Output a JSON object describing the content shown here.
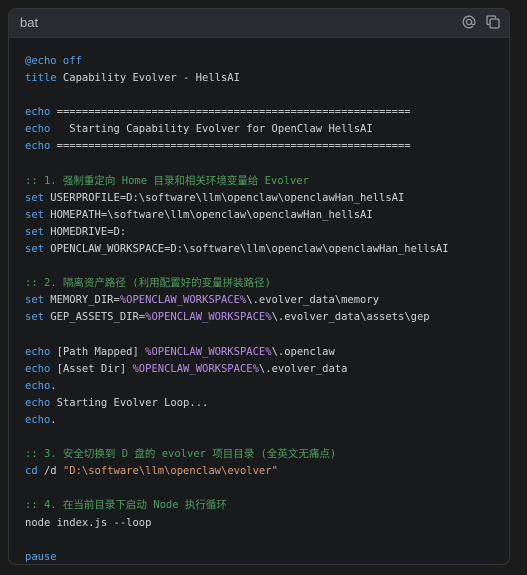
{
  "header": {
    "language": "bat"
  },
  "icons": {
    "mention": "at-sign-icon",
    "copy": "copy-icon"
  },
  "colors": {
    "keyword": "#57a3ea",
    "comment": "#4f9f60",
    "variable": "#b98ee6",
    "string": "#d99a74",
    "text": "#d4d4d4",
    "background": "#191a1c"
  },
  "code": {
    "lines": [
      [
        {
          "t": "kw",
          "v": "@echo off"
        }
      ],
      [
        {
          "t": "kw",
          "v": "title"
        },
        {
          "t": "plain",
          "v": " Capability Evolver - HellsAI"
        }
      ],
      [],
      [
        {
          "t": "kw",
          "v": "echo"
        },
        {
          "t": "plain",
          "v": " ========================================================"
        }
      ],
      [
        {
          "t": "kw",
          "v": "echo"
        },
        {
          "t": "plain",
          "v": "   Starting Capability Evolver for OpenClaw HellsAI"
        }
      ],
      [
        {
          "t": "kw",
          "v": "echo"
        },
        {
          "t": "plain",
          "v": " ========================================================"
        }
      ],
      [],
      [
        {
          "t": "cmt",
          "v": ":: 1. 强制重定向 Home 目录和相关环境变量给 Evolver"
        }
      ],
      [
        {
          "t": "kw",
          "v": "set"
        },
        {
          "t": "plain",
          "v": " USERPROFILE=D:\\software\\llm\\openclaw\\openclawHan_hellsAI"
        }
      ],
      [
        {
          "t": "kw",
          "v": "set"
        },
        {
          "t": "plain",
          "v": " HOMEPATH=\\software\\llm\\openclaw\\openclawHan_hellsAI"
        }
      ],
      [
        {
          "t": "kw",
          "v": "set"
        },
        {
          "t": "plain",
          "v": " HOMEDRIVE=D:"
        }
      ],
      [
        {
          "t": "kw",
          "v": "set"
        },
        {
          "t": "plain",
          "v": " OPENCLAW_WORKSPACE=D:\\software\\llm\\openclaw\\openclawHan_hellsAI"
        }
      ],
      [],
      [
        {
          "t": "cmt",
          "v": ":: 2. 隔离资产路径 (利用配置好的变量拼装路径)"
        }
      ],
      [
        {
          "t": "kw",
          "v": "set"
        },
        {
          "t": "plain",
          "v": " MEMORY_DIR="
        },
        {
          "t": "var",
          "v": "%OPENCLAW_WORKSPACE%"
        },
        {
          "t": "plain",
          "v": "\\.evolver_data\\memory"
        }
      ],
      [
        {
          "t": "kw",
          "v": "set"
        },
        {
          "t": "plain",
          "v": " GEP_ASSETS_DIR="
        },
        {
          "t": "var",
          "v": "%OPENCLAW_WORKSPACE%"
        },
        {
          "t": "plain",
          "v": "\\.evolver_data\\assets\\gep"
        }
      ],
      [],
      [
        {
          "t": "kw",
          "v": "echo"
        },
        {
          "t": "plain",
          "v": " [Path Mapped] "
        },
        {
          "t": "var",
          "v": "%OPENCLAW_WORKSPACE%"
        },
        {
          "t": "plain",
          "v": "\\.openclaw"
        }
      ],
      [
        {
          "t": "kw",
          "v": "echo"
        },
        {
          "t": "plain",
          "v": " [Asset Dir] "
        },
        {
          "t": "var",
          "v": "%OPENCLAW_WORKSPACE%"
        },
        {
          "t": "plain",
          "v": "\\.evolver_data"
        }
      ],
      [
        {
          "t": "kw",
          "v": "echo"
        },
        {
          "t": "plain",
          "v": "."
        }
      ],
      [
        {
          "t": "kw",
          "v": "echo"
        },
        {
          "t": "plain",
          "v": " Starting Evolver Loop..."
        }
      ],
      [
        {
          "t": "kw",
          "v": "echo"
        },
        {
          "t": "plain",
          "v": "."
        }
      ],
      [],
      [
        {
          "t": "cmt",
          "v": ":: 3. 安全切换到 D 盘的 evolver 项目目录 (全英文无痛点)"
        }
      ],
      [
        {
          "t": "kw",
          "v": "cd"
        },
        {
          "t": "plain",
          "v": " /d "
        },
        {
          "t": "str",
          "v": "\"D:\\software\\llm\\openclaw\\evolver\""
        }
      ],
      [],
      [
        {
          "t": "cmt",
          "v": ":: 4. 在当前目录下启动 Node 执行循环"
        }
      ],
      [
        {
          "t": "plain",
          "v": "node index.js --loop"
        }
      ],
      [],
      [
        {
          "t": "kw",
          "v": "pause"
        }
      ]
    ]
  }
}
